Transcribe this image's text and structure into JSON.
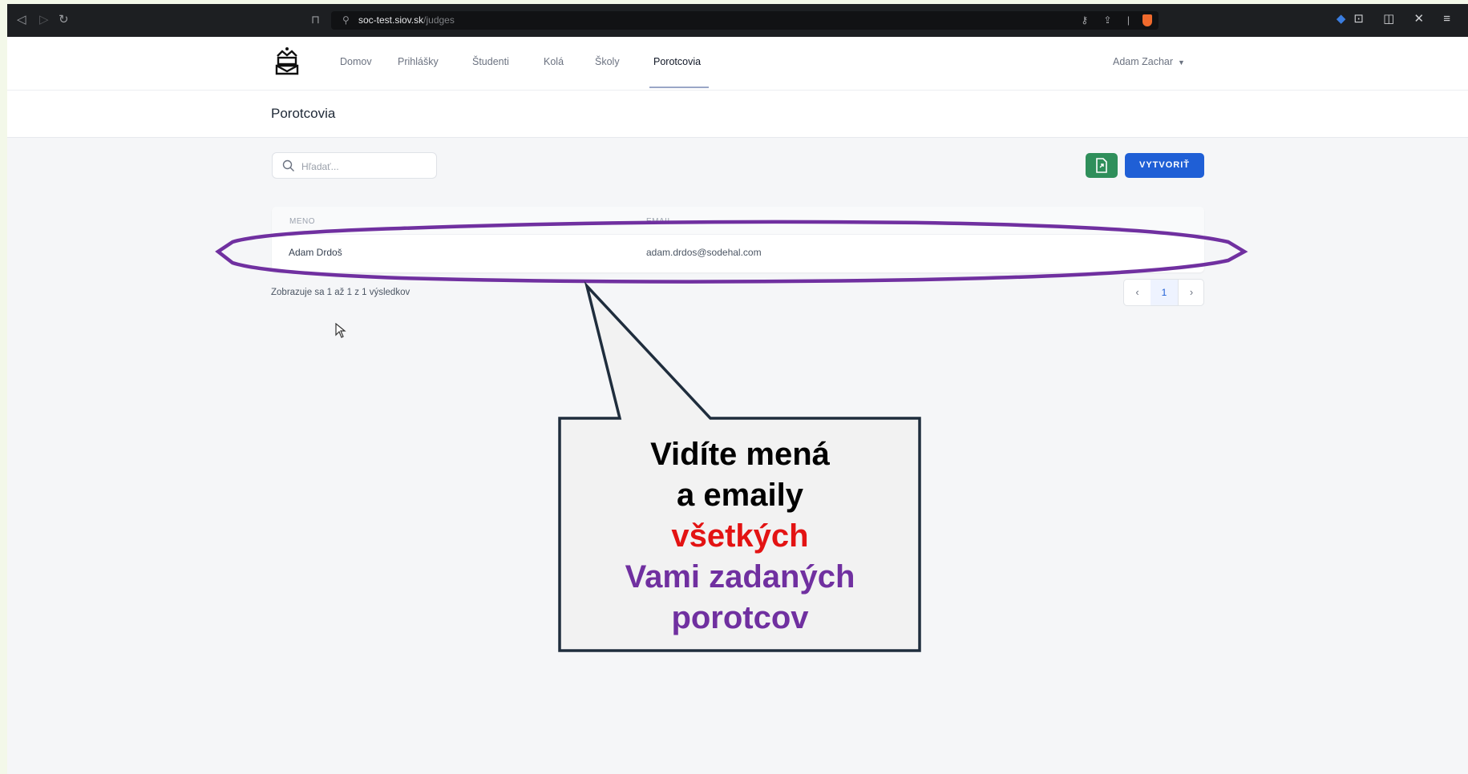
{
  "browser": {
    "url_host": "soc-test.siov.sk",
    "url_path": "/judges"
  },
  "nav": {
    "items": [
      {
        "label": "Domov"
      },
      {
        "label": "Prihlášky"
      },
      {
        "label": "Študenti"
      },
      {
        "label": "Kolá"
      },
      {
        "label": "Školy"
      },
      {
        "label": "Porotcovia"
      }
    ],
    "active": "Porotcovia",
    "user_name": "Adam Zachar"
  },
  "page": {
    "title": "Porotcovia"
  },
  "search": {
    "placeholder": "Hľadať..."
  },
  "toolbar": {
    "create_label": "VYTVORIŤ"
  },
  "table": {
    "columns": [
      "MENO",
      "EMAIL"
    ],
    "rows": [
      {
        "name": "Adam Drdoš",
        "email": "adam.drdos@sodehal.com"
      }
    ]
  },
  "results": {
    "info": "Zobrazuje sa 1 až 1 z 1 výsledkov"
  },
  "pagination": {
    "prev": "‹",
    "current": "1",
    "next": "›"
  },
  "annotation": {
    "line1": "Vidíte mená",
    "line2": "a emaily",
    "line3": "všetkých",
    "line4": "Vami zadaných",
    "line5": "porotcov",
    "colors": {
      "ellipse": "#7030a0",
      "emphasis": "#e31313",
      "text_purple": "#7030a0",
      "box_border": "#1f2d3d",
      "box_fill": "#f2f2f2"
    }
  },
  "colors": {
    "primary": "#1f5fd6",
    "export": "#2f8f5b",
    "page_background": "#f5f6f8",
    "outer_frame": "#f3f8e9"
  }
}
